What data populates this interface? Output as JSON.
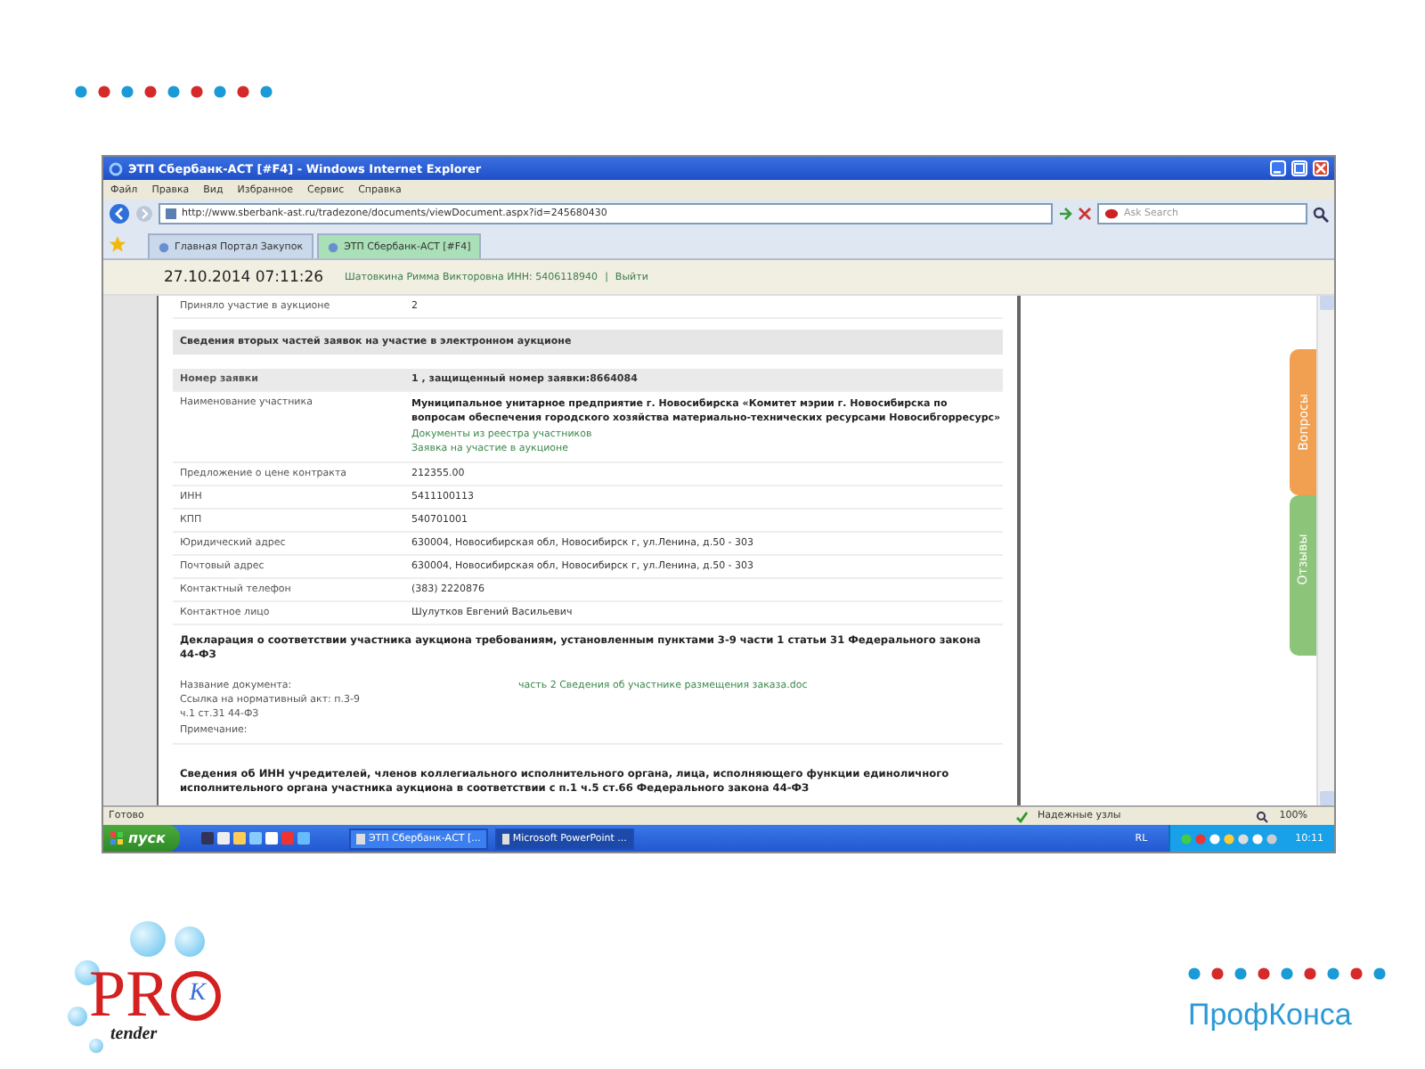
{
  "window": {
    "title": "ЭТП Сбербанк-АСТ [#F4] - Windows Internet Explorer"
  },
  "menu": [
    "Файл",
    "Правка",
    "Вид",
    "Избранное",
    "Сервис",
    "Справка"
  ],
  "address": {
    "value": "http://www.sberbank-ast.ru/tradezone/documents/viewDocument.aspx?id=245680430"
  },
  "search": {
    "placeholder": "Ask Search"
  },
  "tabs": [
    {
      "label": "Главная Портал Закупок",
      "selected": false
    },
    {
      "label": "ЭТП Сбербанк-АСТ [#F4]",
      "selected": true
    }
  ],
  "header": {
    "datetime": "27.10.2014 07:11:26",
    "user": "Шатовкина Римма Викторовна ИНН: 5406118940",
    "separator": "|",
    "logout": "Выйти"
  },
  "content": [
    {
      "kind": "row",
      "label": "Приняло участие в аукционе",
      "value": "2"
    },
    {
      "kind": "section",
      "text": "Сведения вторых частей заявок на участие в электронном аукционе"
    },
    {
      "kind": "head",
      "label": "Номер заявки",
      "value": "1 , защищенный номер заявки:8664084"
    },
    {
      "kind": "name",
      "label": "Наименование участника",
      "value": "Муниципальное унитарное предприятие г. Новосибирска «Комитет мэрии г. Новосибирска по вопросам обеспечения городского хозяйства материально-технических ресурсами Новосибгорресурс»",
      "links": [
        "Документы из реестра участников",
        "Заявка на участие в аукционе"
      ]
    },
    {
      "kind": "row",
      "label": "Предложение о цене контракта",
      "value": "212355.00"
    },
    {
      "kind": "row",
      "label": "ИНН",
      "value": "5411100113"
    },
    {
      "kind": "row",
      "label": "КПП",
      "value": "540701001"
    },
    {
      "kind": "row",
      "label": "Юридический адрес",
      "value": "630004, Новосибирская обл, Новосибирск г, ул.Ленина, д.50 - 303"
    },
    {
      "kind": "row",
      "label": "Почтовый адрес",
      "value": "630004, Новосибирская обл, Новосибирск г, ул.Ленина, д.50 - 303"
    },
    {
      "kind": "row",
      "label": "Контактный телефон",
      "value": "(383) 2220876"
    },
    {
      "kind": "row",
      "label": "Контактное лицо",
      "value": "Шулутков Евгений Васильевич"
    },
    {
      "kind": "bold",
      "text": "Декларация о соответствии участника аукциона требованиям, установленным пунктами 3-9 части 1 статьи 31 Федерального закона 44-ФЗ"
    },
    {
      "kind": "doc",
      "lines": [
        "Название документа:",
        "Ссылка на нормативный акт: п.3-9 ч.1 ст.31 44-ФЗ",
        "Примечание:"
      ],
      "link": "часть 2 Сведения об участнике размещения заказа.doc"
    },
    {
      "kind": "bold",
      "text": "Сведения об ИНН учредителей, членов коллегиального исполнительного органа, лица, исполняющего функции единоличного исполнительного органа участника аукциона в соответствии с п.1 ч.5 ст.66 Федерального закона 44-ФЗ"
    }
  ],
  "side_tabs": [
    {
      "label": "Вопросы",
      "color": "#f0a050"
    },
    {
      "label": "Отзывы",
      "color": "#8cc47a"
    }
  ],
  "status_bar": {
    "text": "Готово",
    "zone": "Надежные узлы",
    "zoom": "100%"
  },
  "taskbar": {
    "start": "пуск",
    "windows": [
      {
        "label": "ЭТП Сбербанк-АСТ [...",
        "selected": false
      },
      {
        "label": "Microsoft PowerPoint ...",
        "selected": true
      }
    ],
    "lang": "RL",
    "clock": "10:11"
  },
  "logo": {
    "letters": "PR",
    "mark": "K",
    "tagline": "tender"
  },
  "footer": {
    "text": "ПрофКонса"
  }
}
